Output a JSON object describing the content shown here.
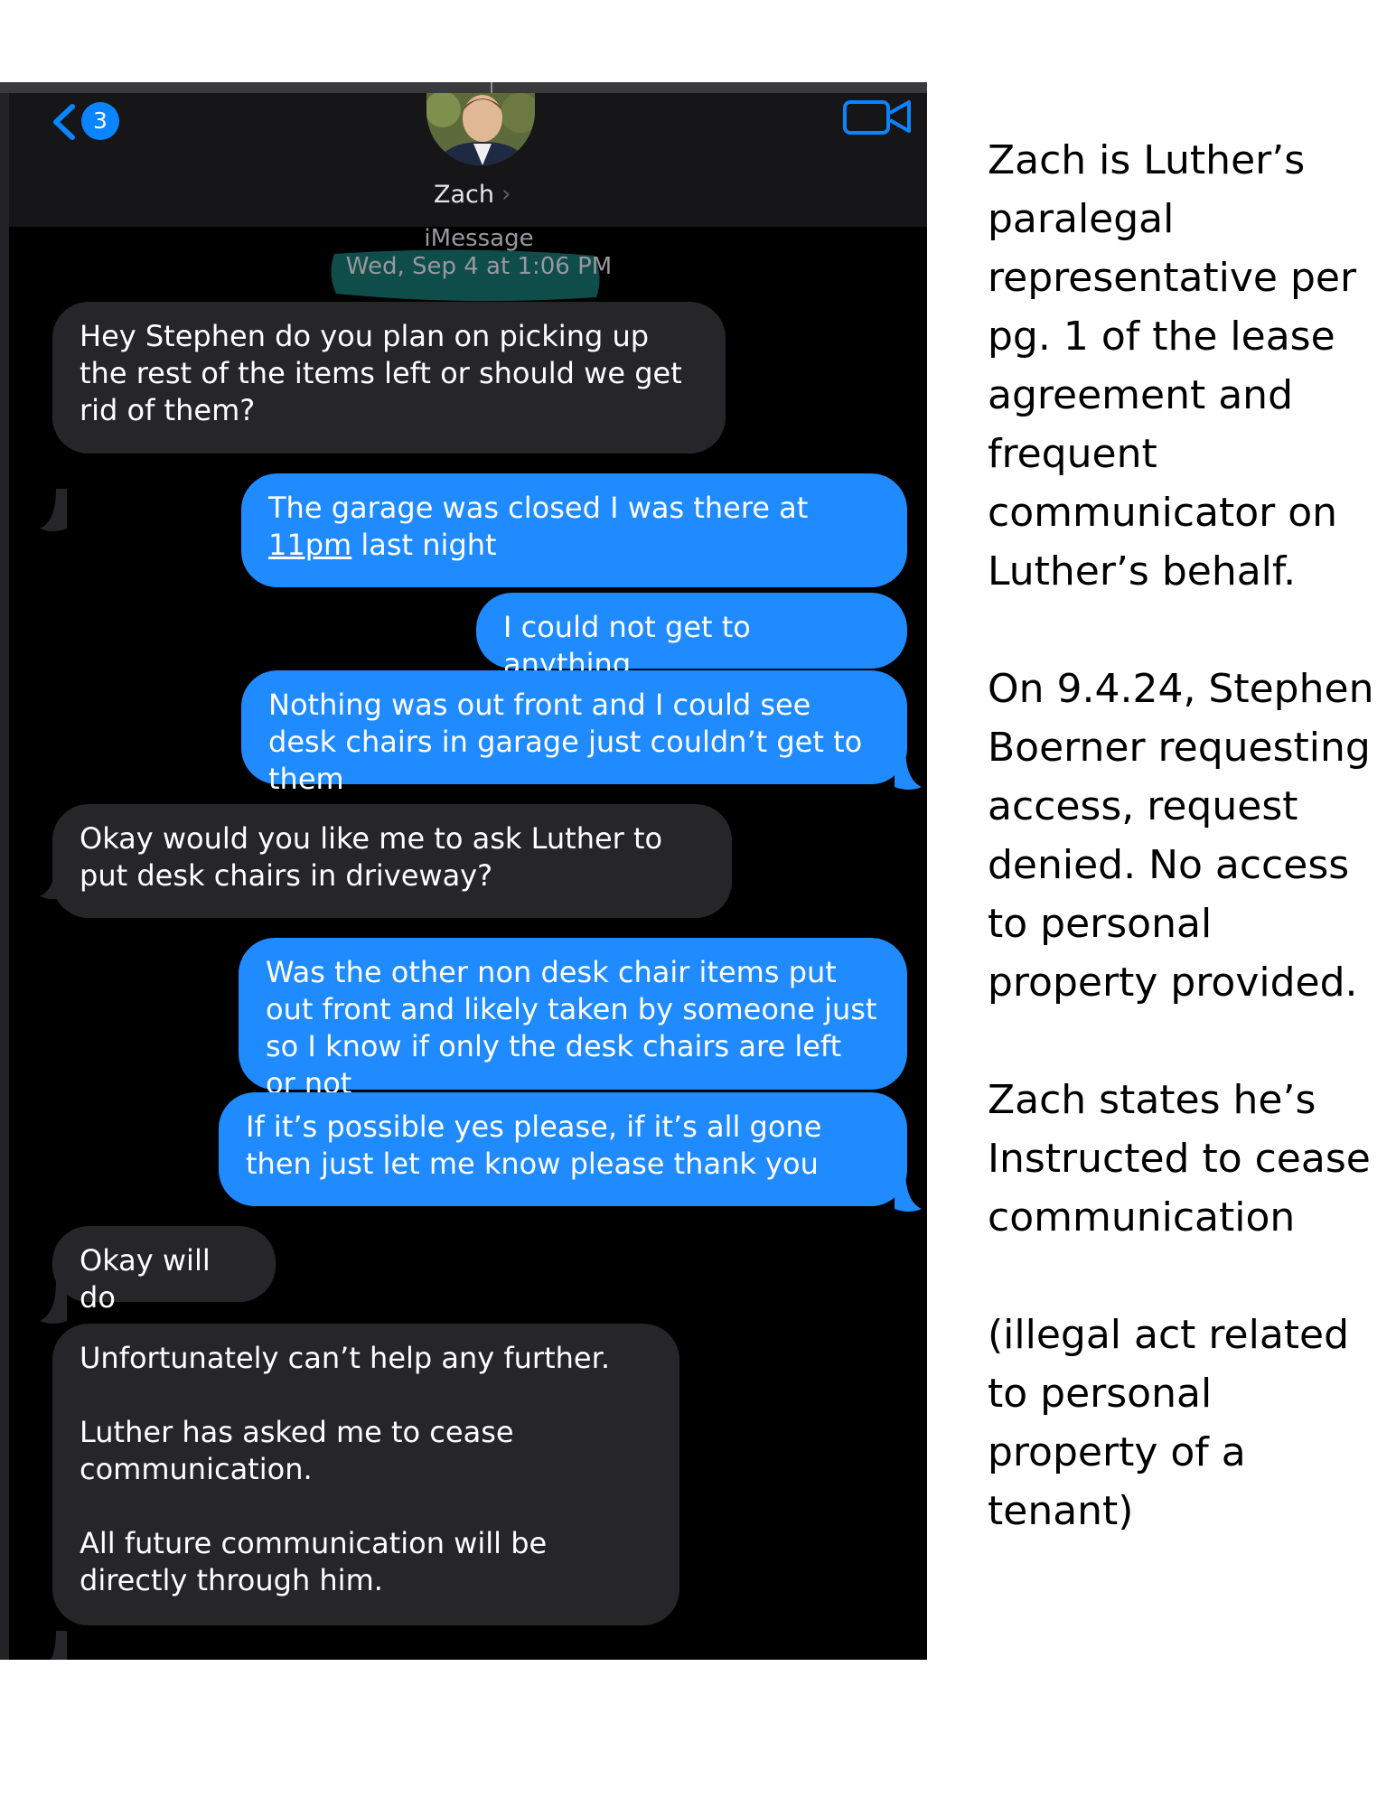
{
  "header": {
    "back_badge": "3",
    "contact_name": "Zach",
    "service_label": "iMessage",
    "timestamp": "Wed, Sep 4 at 1:06 PM"
  },
  "messages": [
    {
      "direction": "received",
      "text": "Hey Stephen do you plan on picking up the rest of the items left or should we get rid of them?"
    },
    {
      "direction": "sent",
      "text_before_link": "The garage was closed I was there at ",
      "link": "11pm",
      "text_after_link": " last night"
    },
    {
      "direction": "sent",
      "text": "I could not get to anything"
    },
    {
      "direction": "sent",
      "text": "Nothing was out front and I could see desk chairs in garage just couldn’t get to them"
    },
    {
      "direction": "received",
      "text": "Okay would you like me to ask Luther to put desk chairs in driveway?"
    },
    {
      "direction": "sent",
      "text": "Was the other non desk chair items put out front and likely taken by someone just so I know if only the desk chairs are left or not"
    },
    {
      "direction": "sent",
      "text": "If it’s possible yes please, if it’s all gone then just let me know please thank you"
    },
    {
      "direction": "received",
      "text": "Okay will do"
    },
    {
      "direction": "received",
      "text": "Unfortunately can’t help any further.\n\nLuther has asked me to cease communication.\n\nAll future communication will be directly through him."
    }
  ],
  "annotation": {
    "paragraphs": [
      "Zach is Luther’s paralegal representative per pg. 1 of the lease agreement and frequent communicator on Luther’s behalf.",
      "On 9.4.24, Stephen Boerner requesting access, request denied. No access to personal property provided.",
      "Zach states he’s Instructed to cease communication",
      "(illegal act related to personal property of a tenant)"
    ]
  },
  "colors": {
    "sent_bubble": "#1f8bff",
    "received_bubble": "#262629",
    "background": "#000000",
    "timestamp_highlight": "#0f4d4a"
  },
  "icons": [
    "back-chevron-icon",
    "video-camera-icon"
  ]
}
